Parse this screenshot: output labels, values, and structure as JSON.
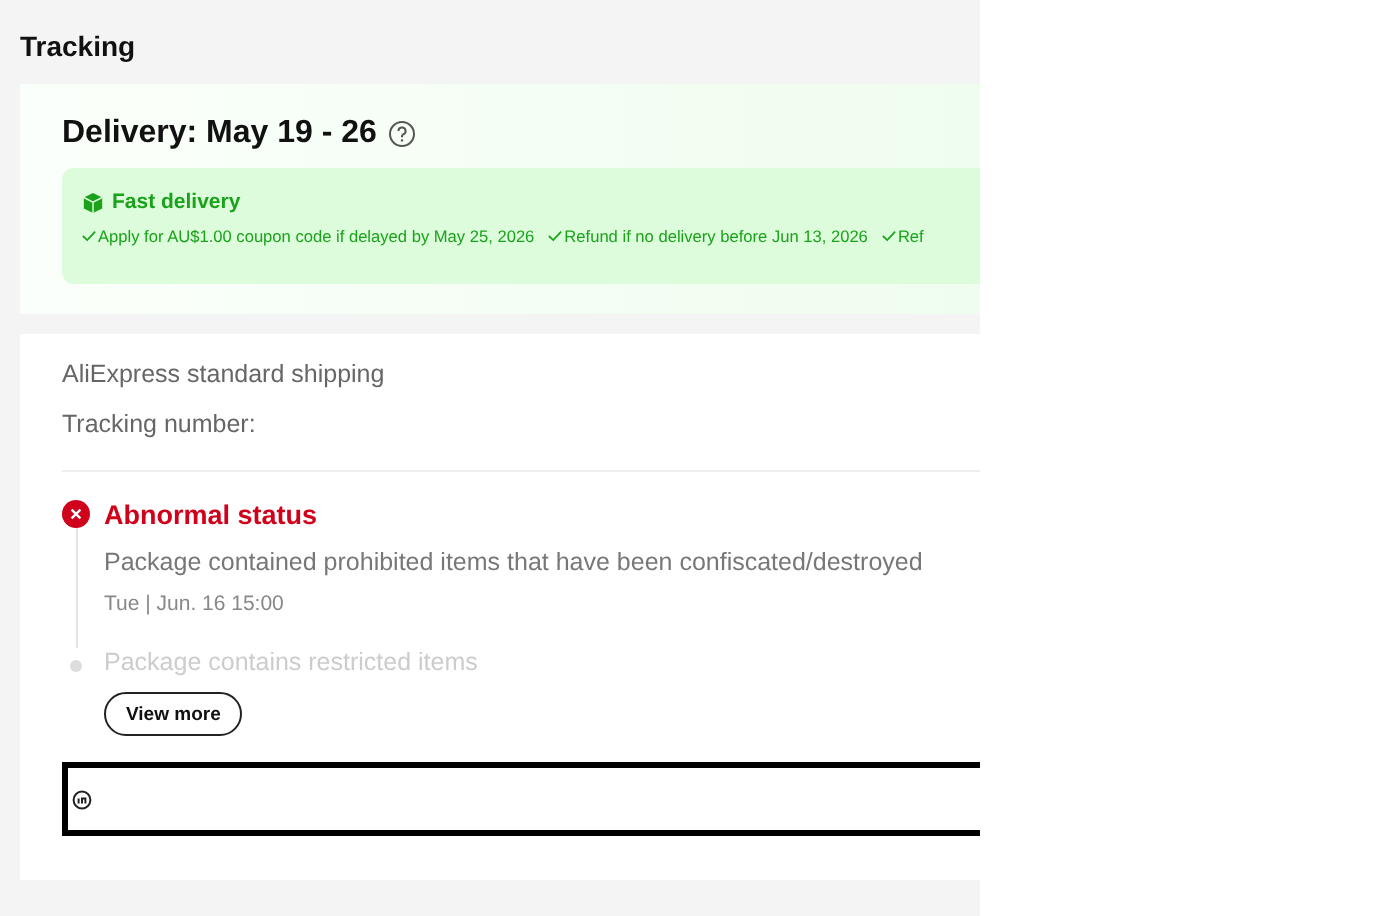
{
  "title": "Tracking",
  "delivery": {
    "heading": "Delivery: May 19 - 26",
    "badge": "Fast delivery",
    "guarantees": [
      "Apply for AU$1.00 coupon code if delayed by May 25, 2026",
      "Refund if no delivery before Jun 13, 2026",
      "Ref"
    ]
  },
  "shipping": {
    "method": "AliExpress standard shipping",
    "tracking_label": "Tracking number:"
  },
  "events": [
    {
      "kind": "abnormal",
      "title": "Abnormal status",
      "description": "Package contained prohibited items that have been confiscated/destroyed",
      "time": "Tue | Jun. 16 15:00"
    },
    {
      "kind": "faded",
      "description": "Package contains restricted items"
    }
  ],
  "view_more": "View more"
}
